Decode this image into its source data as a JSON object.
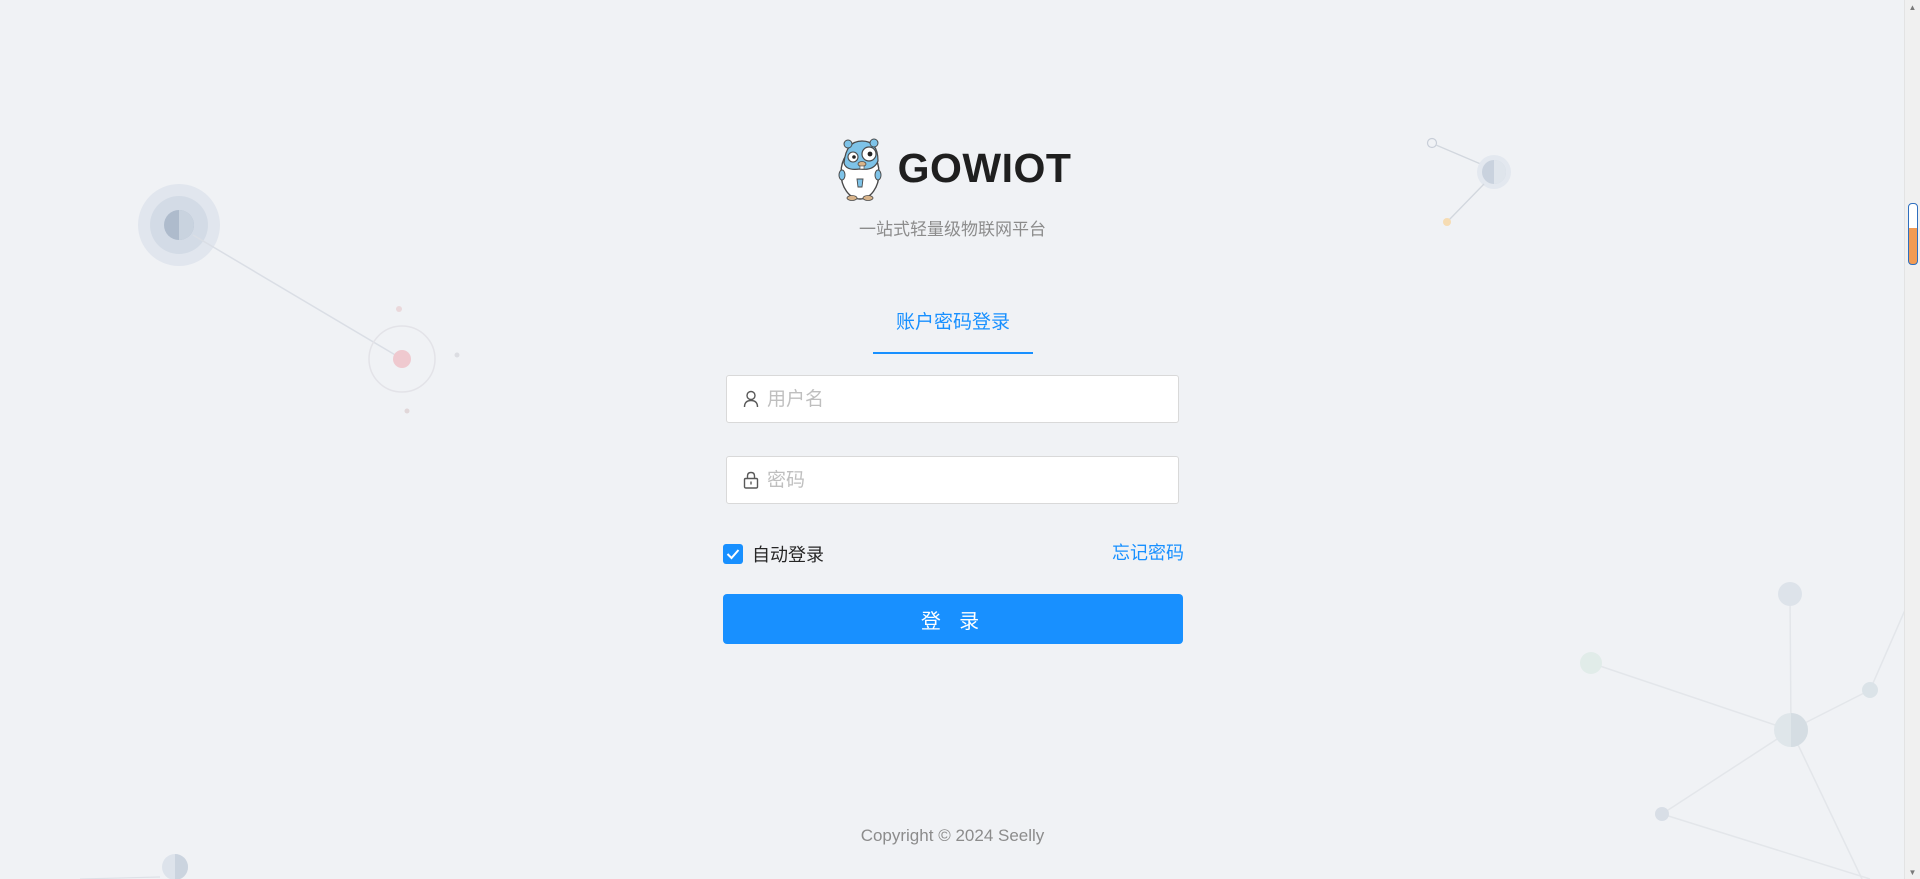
{
  "brand": {
    "title": "GOWIOT",
    "subtitle": "一站式轻量级物联网平台",
    "logo_icon": "gopher-mascot-icon"
  },
  "tabs": [
    {
      "label": "账户密码登录",
      "active": true
    }
  ],
  "form": {
    "username": {
      "placeholder": "用户名",
      "value": "",
      "icon": "user-icon"
    },
    "password": {
      "placeholder": "密码",
      "value": "",
      "icon": "lock-icon"
    },
    "remember": {
      "label": "自动登录",
      "checked": true
    },
    "forgot_label": "忘记密码",
    "submit_label": "登 录"
  },
  "footer": {
    "copyright_prefix": "Copyright",
    "copyright_symbol": "©",
    "copyright_rest": "2024 Seelly"
  },
  "colors": {
    "primary": "#1890ff",
    "background": "#f0f2f5"
  }
}
